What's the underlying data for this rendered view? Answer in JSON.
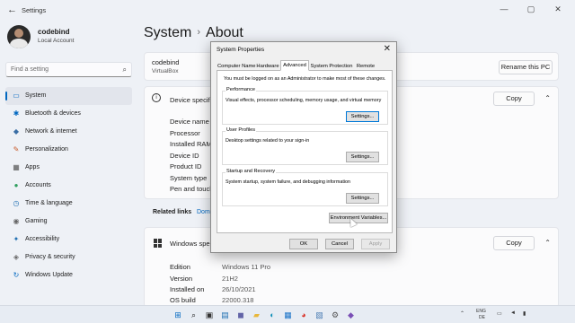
{
  "window": {
    "title": "Settings",
    "back": "←",
    "minimize": "—",
    "maximize": "▢",
    "close": "✕"
  },
  "profile": {
    "name": "codebind",
    "role": "Local Account"
  },
  "search": {
    "placeholder": "Find a setting",
    "icon": "⌕"
  },
  "sidebar": {
    "items": [
      {
        "label": "System",
        "icon": "▭",
        "color": "#0067c0",
        "active": true
      },
      {
        "label": "Bluetooth & devices",
        "icon": "✱",
        "color": "#0067c0"
      },
      {
        "label": "Network & internet",
        "icon": "◆",
        "color": "#3a6ea5"
      },
      {
        "label": "Personalization",
        "icon": "✎",
        "color": "#c85a2a"
      },
      {
        "label": "Apps",
        "icon": "▦",
        "color": "#555555"
      },
      {
        "label": "Accounts",
        "icon": "●",
        "color": "#2e9e5e"
      },
      {
        "label": "Time & language",
        "icon": "◷",
        "color": "#1f6fb2"
      },
      {
        "label": "Gaming",
        "icon": "◉",
        "color": "#666666"
      },
      {
        "label": "Accessibility",
        "icon": "✦",
        "color": "#1f6fb2"
      },
      {
        "label": "Privacy & security",
        "icon": "◈",
        "color": "#666666"
      },
      {
        "label": "Windows Update",
        "icon": "↻",
        "color": "#0067c0"
      }
    ]
  },
  "page": {
    "crumb1": "System",
    "sep": "›",
    "crumb2": "About"
  },
  "device_card": {
    "name": "codebind",
    "model": "VirtualBox",
    "rename_button": "Rename this PC"
  },
  "device_specs": {
    "title": "Device specific",
    "copy": "Copy",
    "chevron": "⌃",
    "labels": [
      "Device name",
      "Processor",
      "Installed RAM",
      "Device ID",
      "Product ID",
      "System type",
      "Pen and touch"
    ]
  },
  "related": {
    "label": "Related links",
    "link1": "Doma",
    "link2": "ns"
  },
  "windows_specs": {
    "title": "Windows speci",
    "copy": "Copy",
    "chevron": "⌃",
    "rows": [
      {
        "label": "Edition",
        "value": "Windows 11 Pro"
      },
      {
        "label": "Version",
        "value": "21H2"
      },
      {
        "label": "Installed on",
        "value": "26/10/2021"
      },
      {
        "label": "OS build",
        "value": "22000.318"
      }
    ]
  },
  "dialog": {
    "title": "System Properties",
    "close": "✕",
    "tabs": [
      "Computer Name",
      "Hardware",
      "Advanced",
      "System Protection",
      "Remote"
    ],
    "active_tab": "Advanced",
    "admin_note": "You must be logged on as an Administrator to make most of these changes.",
    "groups": [
      {
        "title": "Performance",
        "desc": "Visual effects, processor scheduling, memory usage, and virtual memory",
        "button": "Settings..."
      },
      {
        "title": "User Profiles",
        "desc": "Desktop settings related to your sign-in",
        "button": "Settings..."
      },
      {
        "title": "Startup and Recovery",
        "desc": "System startup, system failure, and debugging information",
        "button": "Settings..."
      }
    ],
    "env_button": "Environment Variables...",
    "ok": "OK",
    "cancel": "Cancel",
    "apply": "Apply"
  },
  "taskbar": {
    "icons": [
      {
        "name": "start-icon",
        "glyph": "⊞",
        "color": "#0067c0"
      },
      {
        "name": "search-icon",
        "glyph": "⌕",
        "color": "#222222"
      },
      {
        "name": "task-view-icon",
        "glyph": "▣",
        "color": "#333333"
      },
      {
        "name": "widgets-icon",
        "glyph": "▤",
        "color": "#1f6fb2"
      },
      {
        "name": "chat-icon",
        "glyph": "◼",
        "color": "#6264a7"
      },
      {
        "name": "file-explorer-icon",
        "glyph": "▰",
        "color": "#e8b73a"
      },
      {
        "name": "edge-icon",
        "glyph": "◐",
        "color": "#0f8fb8"
      },
      {
        "name": "store-icon",
        "glyph": "▦",
        "color": "#1a73c8"
      },
      {
        "name": "chrome-icon",
        "glyph": "◕",
        "color": "#d93025"
      },
      {
        "name": "control-panel-icon",
        "glyph": "▧",
        "color": "#4a7cb3"
      },
      {
        "name": "settings-icon",
        "glyph": "⚙",
        "color": "#555555"
      },
      {
        "name": "app-icon",
        "glyph": "◆",
        "color": "#7a4fb5"
      }
    ],
    "tray": {
      "chevron": "⌃",
      "lang_top": "ENG",
      "lang_bottom": "DE",
      "network": "▭",
      "volume": "◄",
      "battery": "▮"
    }
  }
}
